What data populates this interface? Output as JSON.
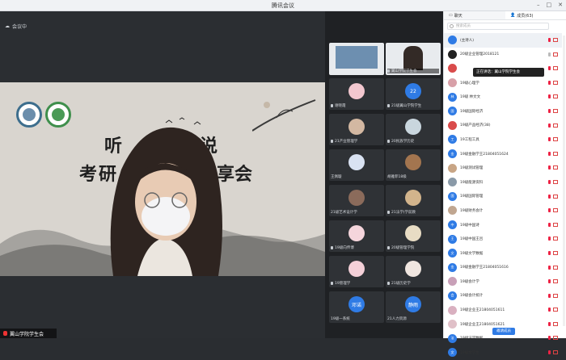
{
  "window": {
    "title": "腾讯会议"
  },
  "stage": {
    "top_label": "会议中",
    "slide_text": {
      "line1_a": "听",
      "line1_b": "说",
      "line2_a": "考研",
      "line2_b": "享会"
    },
    "speaker_name": "翼山学院学生会"
  },
  "grid": {
    "tiles": [
      {
        "name": "",
        "type": "feed",
        "color": "#e4e8ec"
      },
      {
        "name": "翼山学院学生会",
        "type": "feed",
        "color": "#eae4dc"
      },
      {
        "name": "谢晓霞",
        "type": "avatar",
        "color": "#f2c7cf"
      },
      {
        "name": "21级翼山学院学生",
        "type": "num",
        "color": "#2f7be5",
        "text": "22"
      },
      {
        "name": "21产业管理学",
        "type": "avatar",
        "color": "#d3b8a2"
      },
      {
        "name": "20民族学历史",
        "type": "avatar",
        "color": "#c9d6de"
      },
      {
        "name": "王佩璇",
        "type": "avatar",
        "color": "#d9e2f2"
      },
      {
        "name": "胡雅菲18级",
        "type": "avatar",
        "color": "#a3754f"
      },
      {
        "name": "21级艺术设计学",
        "type": "avatar",
        "color": "#8b6b5b"
      },
      {
        "name": "21法学(学前教",
        "type": "avatar",
        "color": "#d2b48c"
      },
      {
        "name": "19级向传博",
        "type": "avatar",
        "color": "#f5d5dc"
      },
      {
        "name": "20级管理学院",
        "type": "avatar",
        "color": "#e8dcc4"
      },
      {
        "name": "19管理学",
        "type": "avatar",
        "color": "#f4d0d8"
      },
      {
        "name": "21级历史学",
        "type": "avatar",
        "color": "#f0e6e0"
      },
      {
        "name": "19级一系统",
        "type": "num",
        "color": "#2f7be5",
        "text": "邓诺"
      },
      {
        "name": "21人力资源",
        "type": "num",
        "color": "#2f7be5",
        "text": "静雨"
      }
    ]
  },
  "panel": {
    "tab_chat": "聊天",
    "tab_members": "成员(63)",
    "search_placeholder": "搜索成员",
    "tooltip": "正在讲话：翼山学院学生会",
    "rows": [
      {
        "name": "(主持人)",
        "color": "#2f7be5",
        "initial": ""
      },
      {
        "name": "20级企业管理2018121",
        "color": "#222",
        "initial": ""
      },
      {
        "name": "",
        "color": "#d94b4b",
        "initial": ""
      },
      {
        "name": "19级心理学",
        "color": "#d8a0a8",
        "initial": ""
      },
      {
        "name": "19级 林文文",
        "color": "#2f7be5",
        "initial": "林"
      },
      {
        "name": "19级国际经济",
        "color": "#2f7be5",
        "initial": "国"
      },
      {
        "name": "19级产品经济(38)",
        "color": "#d94b4b",
        "initial": ""
      },
      {
        "name": "19工程工具",
        "color": "#2f7be5",
        "initial": "工"
      },
      {
        "name": "19级金融学王21804051624",
        "color": "#2f7be5",
        "initial": "金"
      },
      {
        "name": "19级测试管理",
        "color": "#c8a585",
        "initial": ""
      },
      {
        "name": "19级能源资料",
        "color": "#8a9aa8",
        "initial": ""
      },
      {
        "name": "19级国际管理",
        "color": "#2f7be5",
        "initial": "国"
      },
      {
        "name": "19级财务会计",
        "color": "#c0a690",
        "initial": ""
      },
      {
        "name": "19级中国诗",
        "color": "#2f7be5",
        "initial": "中"
      },
      {
        "name": "19级中国王吕",
        "color": "#2f7be5",
        "initial": "王"
      },
      {
        "name": "19级文学数据",
        "color": "#2f7be5",
        "initial": "文"
      },
      {
        "name": "19级金融学王21804051616",
        "color": "#2f7be5",
        "initial": "金"
      },
      {
        "name": "19级会计学",
        "color": "#c8a0b8",
        "initial": ""
      },
      {
        "name": "19级会计统计",
        "color": "#2f7be5",
        "initial": "会"
      },
      {
        "name": "19级企业王21804051611",
        "color": "#d9b0c0",
        "initial": ""
      },
      {
        "name": "19级企业王21804051621",
        "color": "#e0c0c8",
        "initial": ""
      },
      {
        "name": "19级法学数据",
        "color": "#2f7be5",
        "initial": "法"
      },
      {
        "name": "19级文学生",
        "color": "#2f7be5",
        "initial": "文"
      }
    ],
    "bottom_button": "邀请成员"
  }
}
